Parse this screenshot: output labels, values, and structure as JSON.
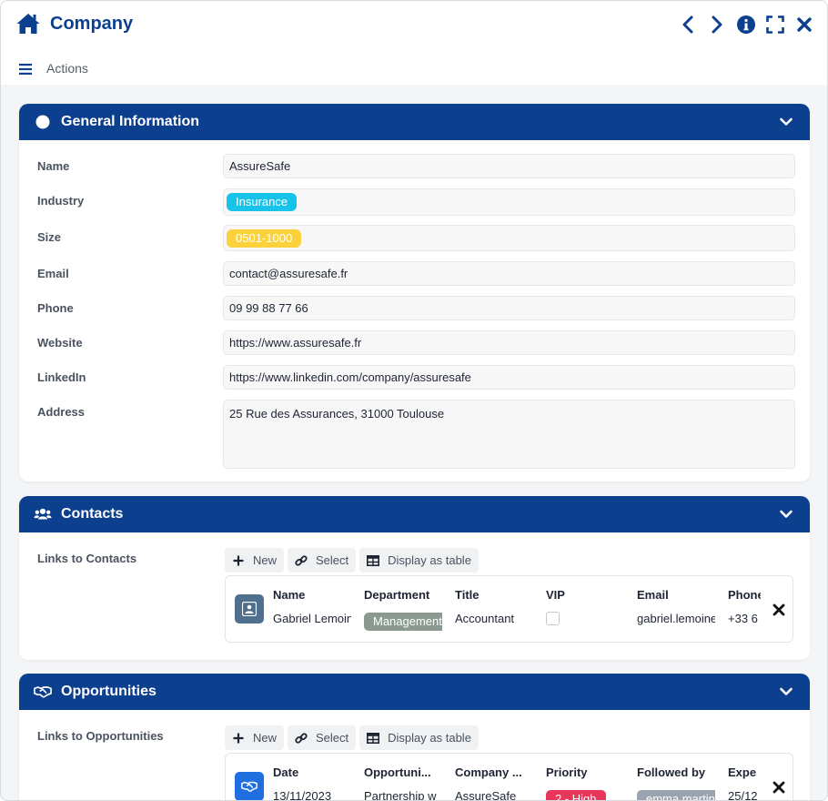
{
  "window": {
    "title": "Company",
    "actions_label": "Actions",
    "icons": [
      "home-icon",
      "chevron-left-icon",
      "chevron-right-icon",
      "info-icon",
      "expand-icon",
      "close-icon",
      "menu-icon"
    ]
  },
  "colors": {
    "primary": "#0d3f8f",
    "industry_pill": "#17c3e8",
    "size_pill": "#fcd23c",
    "department_tag": "#8a9a90",
    "priority_high": "#e8365a",
    "followed_by_tag": "#9aa3b0"
  },
  "general": {
    "title": "General Information",
    "fields": {
      "name": {
        "label": "Name",
        "value": "AssureSafe"
      },
      "industry": {
        "label": "Industry",
        "value": "Insurance"
      },
      "size": {
        "label": "Size",
        "value": "0501-1000"
      },
      "email": {
        "label": "Email",
        "value": "contact@assuresafe.fr"
      },
      "phone": {
        "label": "Phone",
        "value": "09 99 88 77 66"
      },
      "website": {
        "label": "Website",
        "value": "https://www.assuresafe.fr"
      },
      "linkedin": {
        "label": "LinkedIn",
        "value": "https://www.linkedin.com/company/assuresafe"
      },
      "address": {
        "label": "Address",
        "value": "25 Rue des Assurances, 31000 Toulouse"
      }
    }
  },
  "toolbar": {
    "new_label": "New",
    "select_label": "Select",
    "table_label": "Display as table"
  },
  "contacts": {
    "title": "Contacts",
    "links_label": "Links to Contacts",
    "columns": [
      "Name",
      "Department",
      "Title",
      "VIP",
      "Email",
      "Phone"
    ],
    "row": {
      "name": "Gabriel Lemoine",
      "department": "Management",
      "title": "Accountant",
      "vip": false,
      "email": "gabriel.lemoine",
      "phone": "+33 6"
    }
  },
  "opportunities": {
    "title": "Opportunities",
    "links_label": "Links to Opportunities",
    "columns": [
      "Date",
      "Opportuni...",
      "Company ...",
      "Priority",
      "Followed by",
      "Expe"
    ],
    "row": {
      "date": "13/11/2023",
      "opportunity": "Partnership w",
      "company": "AssureSafe",
      "priority": "2 - High",
      "followed_by": "emma martin",
      "expected": "25/12"
    }
  }
}
